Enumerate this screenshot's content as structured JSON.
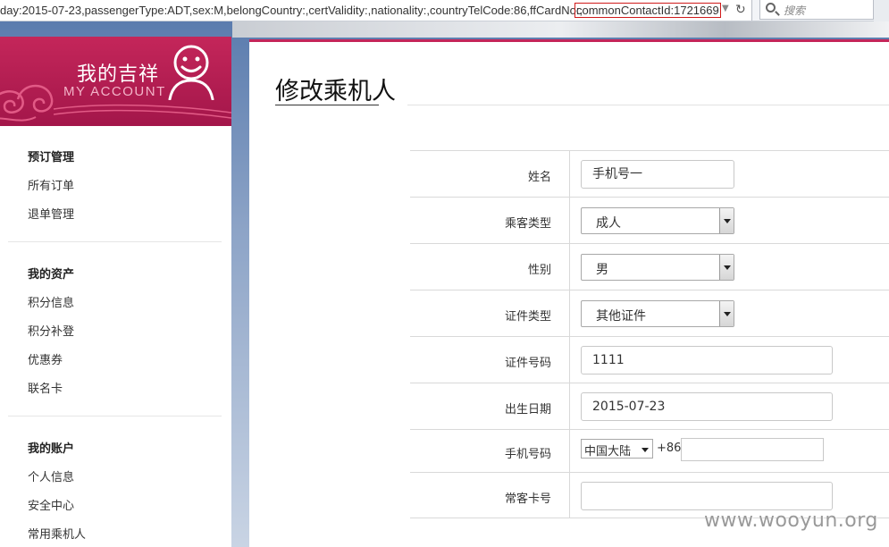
{
  "browser": {
    "url": "day:2015-07-23,passengerType:ADT,sex:M,belongCountry:,certValidity:,nationality:,countryTelCode:86,ffCardNo:,",
    "url_highlight": "commonContactId:1721669",
    "search_placeholder": "搜索"
  },
  "sidebar": {
    "banner_title": "我的吉祥",
    "banner_subtitle": "MY ACCOUNT",
    "groups": [
      {
        "heading": "预订管理",
        "items": [
          "所有订单",
          "退单管理"
        ]
      },
      {
        "heading": "我的资产",
        "items": [
          "积分信息",
          "积分补登",
          "优惠券",
          "联名卡"
        ]
      },
      {
        "heading": "我的账户",
        "items": [
          "个人信息",
          "安全中心",
          "常用乘机人"
        ]
      }
    ]
  },
  "main": {
    "title": "修改乘机人",
    "form": {
      "name": {
        "label": "姓名",
        "value": "手机号一"
      },
      "passenger_type": {
        "label": "乘客类型",
        "value": "成人"
      },
      "gender": {
        "label": "性别",
        "value": "男"
      },
      "id_type": {
        "label": "证件类型",
        "value": "其他证件"
      },
      "id_number": {
        "label": "证件号码",
        "value": "1111"
      },
      "birth_date": {
        "label": "出生日期",
        "value": "2015-07-23"
      },
      "phone": {
        "label": "手机号码",
        "country": "中国大陆",
        "code": "+86",
        "value": ""
      },
      "ff_card": {
        "label": "常客卡号",
        "value": ""
      }
    }
  },
  "watermark": "www.wooyun.org",
  "colors": {
    "accent": "#c4265a",
    "banner": "#a3164a"
  }
}
